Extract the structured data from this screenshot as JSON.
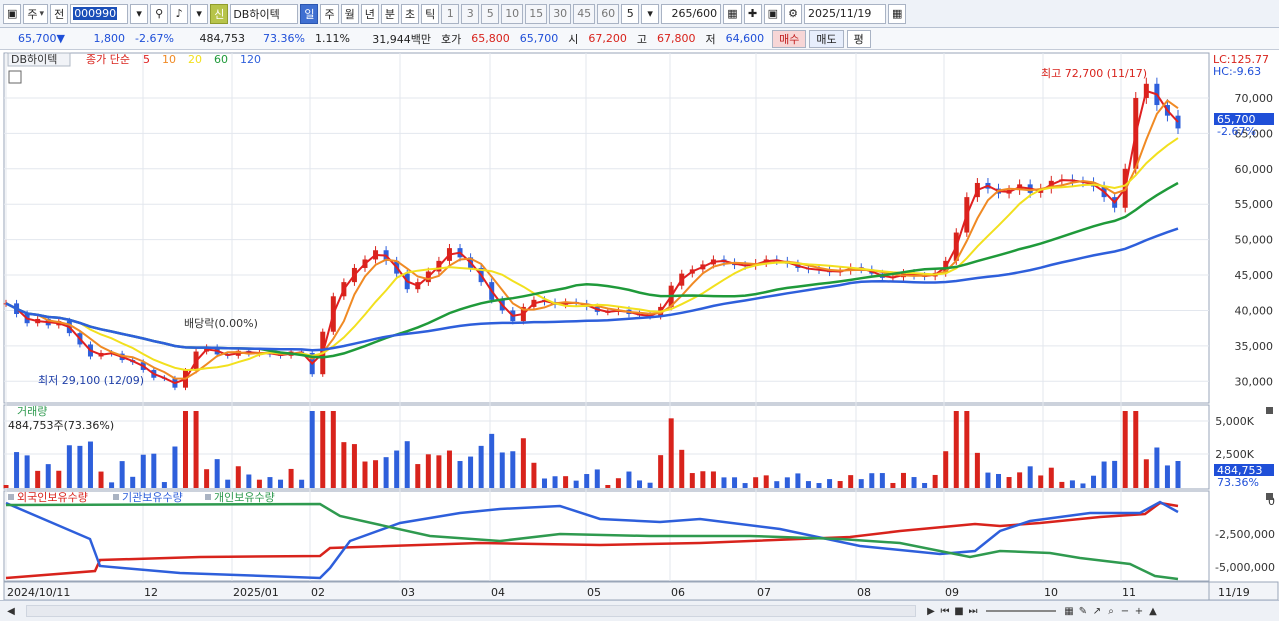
{
  "toolbar": {
    "market": "주",
    "prev": "전",
    "code": "000990",
    "badge": "신",
    "name": "DB하이텍",
    "periods": [
      "일",
      "주",
      "월",
      "년",
      "분",
      "초",
      "틱"
    ],
    "active_period": "일",
    "minutes": [
      "1",
      "3",
      "5",
      "10",
      "15",
      "30",
      "45",
      "60"
    ],
    "interval": "5",
    "count": "265/600",
    "date": "2025/11/19"
  },
  "quote": {
    "price": "65,700▼",
    "change": "1,800",
    "change_pct": "-2.67%",
    "volume": "484,753",
    "volume_ratio": "73.36%",
    "turnover": "1.11%",
    "amount": "31,944백만",
    "ask_label": "호가",
    "ask1": "65,800",
    "ask2": "65,700",
    "open_label": "시",
    "open": "67,200",
    "high_label": "고",
    "high": "67,800",
    "low_label": "저",
    "low": "64,600",
    "buy": "매수",
    "sell": "매도",
    "eval": "평"
  },
  "price_panel": {
    "stock_tag": "DB하이텍",
    "legend_label": "종가 단순",
    "ma_periods": [
      "5",
      "10",
      "20",
      "60",
      "120"
    ],
    "ma_colors": [
      "#e02020",
      "#f08a24",
      "#f2e01e",
      "#1f9a3a",
      "#2e5fdb"
    ],
    "lc": "LC:125.77",
    "hc": "HC:-9.63",
    "high_annot": "최고 72,700 (11/17)",
    "low_annot": "최저 29,100 (12/09)",
    "dividend_annot": "배당락(0.00%)",
    "current_price": "65,700",
    "current_pct": "-2.67%",
    "y_ticks": [
      "70,000",
      "65,000",
      "60,000",
      "55,000",
      "50,000",
      "45,000",
      "40,000",
      "35,000",
      "30,000"
    ]
  },
  "volume_panel": {
    "label": "거래량",
    "value": "484,753주(73.36%)",
    "y_ticks": [
      "5,000K",
      "2,500K"
    ],
    "current": "484,753",
    "current_pct": "73.36%"
  },
  "holdings_panel": {
    "labels": [
      "외국인보유수량",
      "기관보유수량",
      "개인보유수량"
    ],
    "colors": [
      "#d8231c",
      "#2e5fdb",
      "#2f9a4f"
    ],
    "y_ticks": [
      "0",
      "-2,500,000",
      "-5,000,000"
    ]
  },
  "x_axis": {
    "labels": [
      "2024/10/11",
      "12",
      "2025/01",
      "02",
      "03",
      "04",
      "05",
      "06",
      "07",
      "08",
      "09",
      "10",
      "11"
    ],
    "right_date": "11/19"
  },
  "chart_data": {
    "type": "candlestick",
    "price_range": [
      27500,
      75500
    ],
    "annotations": {
      "high": 72700,
      "low": 29100
    },
    "closes": [
      41000,
      39500,
      38200,
      38800,
      37900,
      38500,
      36800,
      35200,
      33500,
      34000,
      33900,
      33000,
      32700,
      31600,
      30500,
      30400,
      29100,
      31500,
      34200,
      34800,
      33800,
      33600,
      34300,
      33900,
      34100,
      33800,
      33600,
      34200,
      34000,
      31000,
      37000,
      42000,
      44000,
      46000,
      47200,
      48500,
      47000,
      45200,
      43000,
      44000,
      45500,
      47000,
      48800,
      47500,
      46000,
      44000,
      41500,
      40000,
      38500,
      40500,
      41500,
      41200,
      40800,
      41200,
      41000,
      40500,
      39800,
      39800,
      40100,
      39500,
      39300,
      39200,
      40500,
      43500,
      45200,
      45800,
      46500,
      47200,
      46800,
      46400,
      46300,
      46700,
      47200,
      47000,
      46600,
      46000,
      45800,
      45700,
      45400,
      45600,
      46100,
      45800,
      45200,
      44600,
      44700,
      45300,
      44900,
      44800,
      45300,
      47000,
      51000,
      56000,
      58000,
      57200,
      56500,
      57000,
      57800,
      56600,
      57200,
      58300,
      58500,
      58200,
      58100,
      57500,
      56000,
      54500,
      60000,
      70000,
      72000,
      69000,
      67500,
      65700
    ],
    "ma_series": [
      "MA5",
      "MA10",
      "MA20",
      "MA60",
      "MA120"
    ]
  }
}
